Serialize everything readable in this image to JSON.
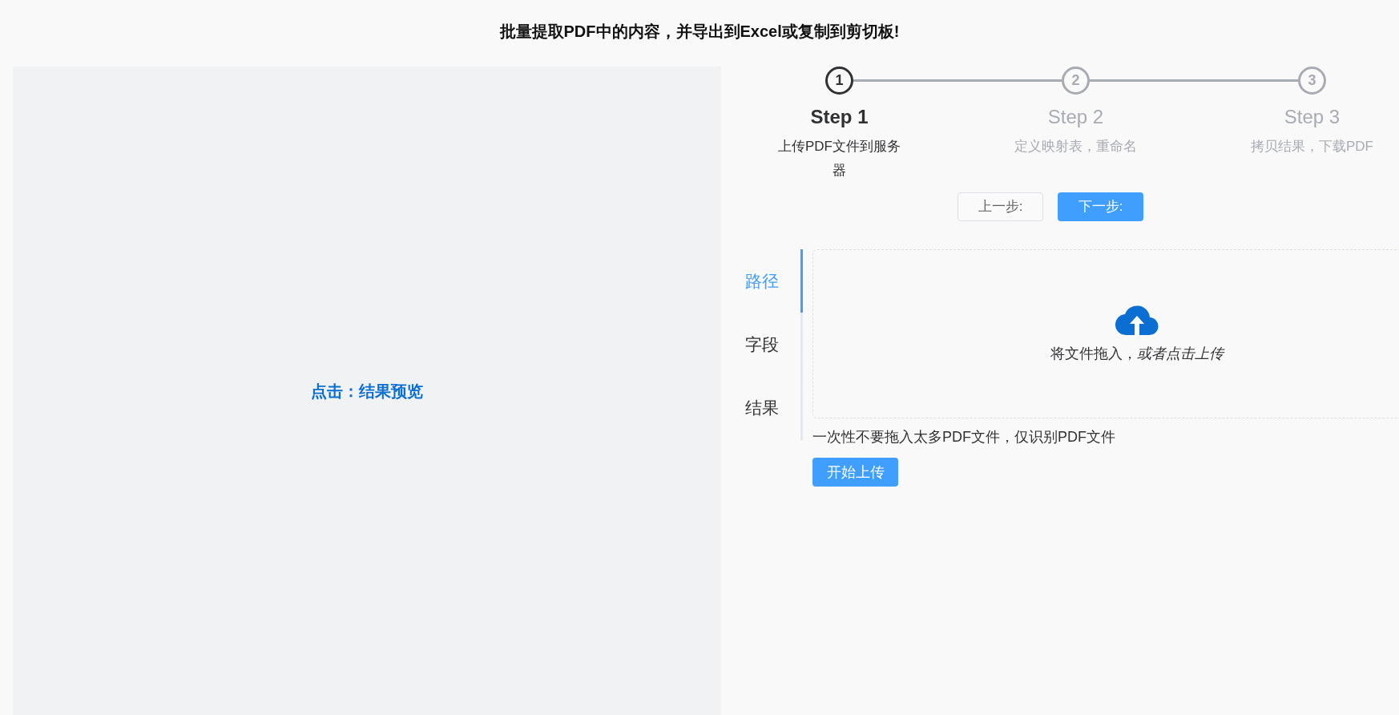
{
  "header": {
    "title": "批量提取PDF中的内容，并导出到Excel或复制到剪切板!"
  },
  "preview": {
    "link": "点击：结果预览"
  },
  "steps": [
    {
      "number": "1",
      "title": "Step 1",
      "description": "上传PDF文件到服务器",
      "selected": true
    },
    {
      "number": "2",
      "title": "Step 2",
      "description": "定义映射表，重命名",
      "selected": false
    },
    {
      "number": "3",
      "title": "Step 3",
      "description": "拷贝结果，下载PDF",
      "selected": false
    }
  ],
  "nav_buttons": {
    "previous": "上一步:",
    "next": "下一步:"
  },
  "tabs": [
    {
      "label": "路径",
      "selected": true
    },
    {
      "label": "字段",
      "selected": false
    },
    {
      "label": "结果",
      "selected": false
    }
  ],
  "upload": {
    "prompt": "将文件拖入，*或者点击上传*",
    "hint": "一次性不要拖入太多PDF文件，仅识别PDF文件",
    "button": "开始上传"
  }
}
